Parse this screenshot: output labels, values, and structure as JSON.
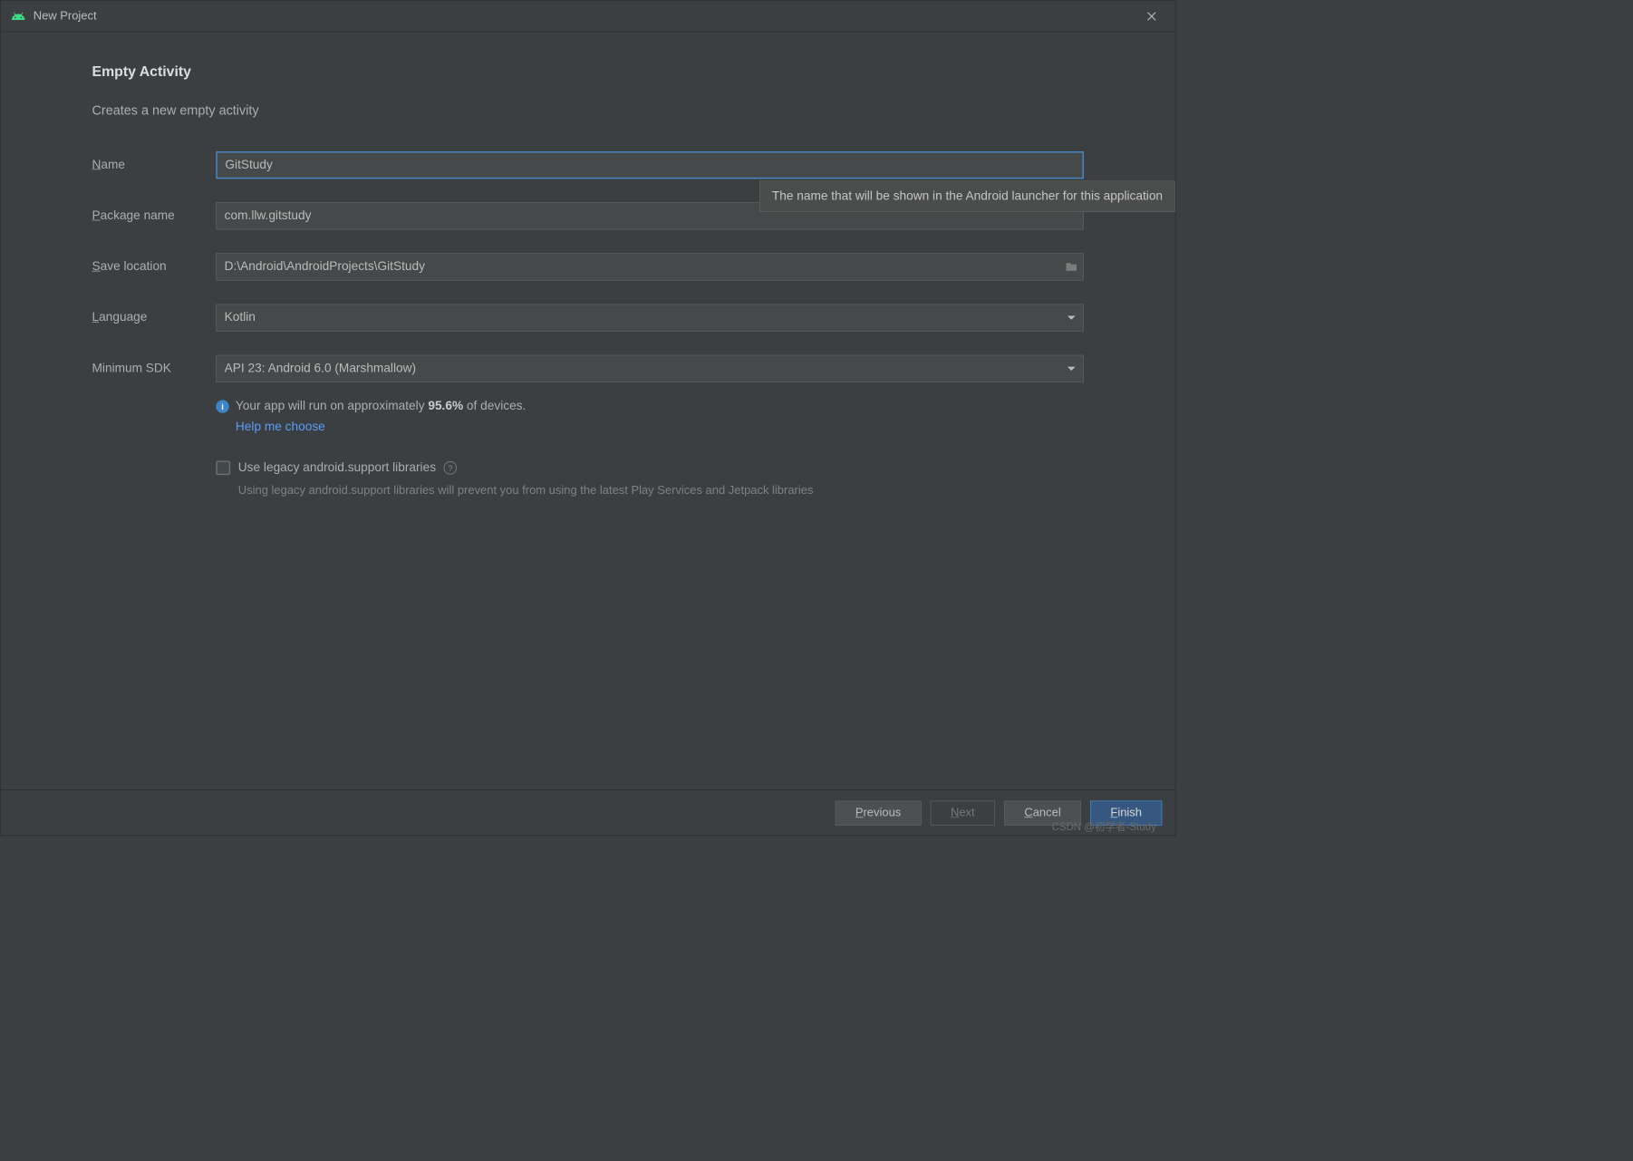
{
  "window": {
    "title": "New Project"
  },
  "form": {
    "heading": "Empty Activity",
    "subtitle": "Creates a new empty activity",
    "name": {
      "label": "Name",
      "value": "GitStudy"
    },
    "package": {
      "label": "Package name",
      "value": "com.llw.gitstudy"
    },
    "save_location": {
      "label": "Save location",
      "value": "D:\\Android\\AndroidProjects\\GitStudy"
    },
    "language": {
      "label": "Language",
      "value": "Kotlin"
    },
    "min_sdk": {
      "label": "Minimum SDK",
      "value": "API 23: Android 6.0 (Marshmallow)"
    },
    "info": {
      "prefix": "Your app will run on approximately ",
      "percentage": "95.6%",
      "suffix": " of devices.",
      "help_link": "Help me choose"
    },
    "legacy": {
      "label": "Use legacy android.support libraries",
      "help": "Using legacy android.support libraries will prevent you from using the latest Play Services and Jetpack libraries"
    }
  },
  "tooltip": "The name that will be shown in the Android launcher for this application",
  "buttons": {
    "previous": "Previous",
    "next": "Next",
    "cancel": "Cancel",
    "finish": "Finish"
  },
  "watermark": "CSDN @初学者-Study"
}
